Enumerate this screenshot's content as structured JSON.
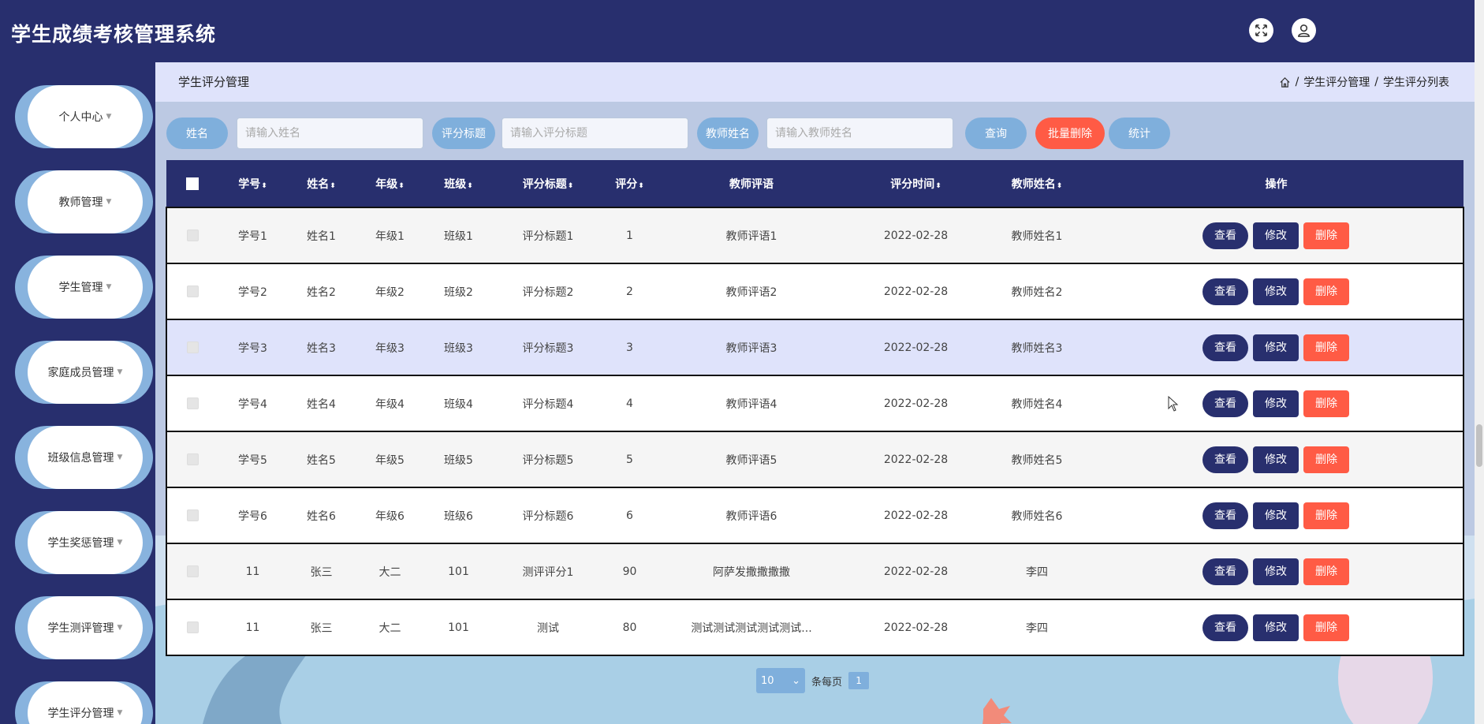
{
  "header": {
    "title": "学生成绩考核管理系统"
  },
  "sidebar": {
    "items": [
      {
        "label": "个人中心"
      },
      {
        "label": "教师管理"
      },
      {
        "label": "学生管理"
      },
      {
        "label": "家庭成员管理"
      },
      {
        "label": "班级信息管理"
      },
      {
        "label": "学生奖惩管理"
      },
      {
        "label": "学生测评管理"
      },
      {
        "label": "学生评分管理"
      }
    ]
  },
  "breadbar": {
    "page_title": "学生评分管理",
    "crumb_1": "学生评分管理",
    "crumb_2": "学生评分列表",
    "separator": "/"
  },
  "filters": {
    "name_label": "姓名",
    "name_placeholder": "请输入姓名",
    "title_label": "评分标题",
    "title_placeholder": "请输入评分标题",
    "teacher_label": "教师姓名",
    "teacher_placeholder": "请输入教师姓名",
    "search_label": "查询",
    "batch_delete_label": "批量删除",
    "stats_label": "统计"
  },
  "table": {
    "headers": {
      "id": "学号",
      "name": "姓名",
      "grade": "年级",
      "class": "班级",
      "title": "评分标题",
      "score": "评分",
      "comment": "教师评语",
      "time": "评分时间",
      "teacher": "教师姓名",
      "actions": "操作"
    },
    "rows": [
      {
        "id": "学号1",
        "name": "姓名1",
        "grade": "年级1",
        "class": "班级1",
        "title": "评分标题1",
        "score": "1",
        "comment": "教师评语1",
        "time": "2022-02-28",
        "teacher": "教师姓名1"
      },
      {
        "id": "学号2",
        "name": "姓名2",
        "grade": "年级2",
        "class": "班级2",
        "title": "评分标题2",
        "score": "2",
        "comment": "教师评语2",
        "time": "2022-02-28",
        "teacher": "教师姓名2"
      },
      {
        "id": "学号3",
        "name": "姓名3",
        "grade": "年级3",
        "class": "班级3",
        "title": "评分标题3",
        "score": "3",
        "comment": "教师评语3",
        "time": "2022-02-28",
        "teacher": "教师姓名3"
      },
      {
        "id": "学号4",
        "name": "姓名4",
        "grade": "年级4",
        "class": "班级4",
        "title": "评分标题4",
        "score": "4",
        "comment": "教师评语4",
        "time": "2022-02-28",
        "teacher": "教师姓名4"
      },
      {
        "id": "学号5",
        "name": "姓名5",
        "grade": "年级5",
        "class": "班级5",
        "title": "评分标题5",
        "score": "5",
        "comment": "教师评语5",
        "time": "2022-02-28",
        "teacher": "教师姓名5"
      },
      {
        "id": "学号6",
        "name": "姓名6",
        "grade": "年级6",
        "class": "班级6",
        "title": "评分标题6",
        "score": "6",
        "comment": "教师评语6",
        "time": "2022-02-28",
        "teacher": "教师姓名6"
      },
      {
        "id": "11",
        "name": "张三",
        "grade": "大二",
        "class": "101",
        "title": "测评评分1",
        "score": "90",
        "comment": "阿萨发撒撒撒撒",
        "time": "2022-02-28",
        "teacher": "李四"
      },
      {
        "id": "11",
        "name": "张三",
        "grade": "大二",
        "class": "101",
        "title": "测试",
        "score": "80",
        "comment": "测试测试测试测试测试...",
        "time": "2022-02-28",
        "teacher": "李四"
      }
    ],
    "action_view": "查看",
    "action_edit": "修改",
    "action_delete": "删除"
  },
  "pager": {
    "page_size": "10",
    "per_page_label": "条每页",
    "current_page": "1"
  },
  "colors": {
    "primary": "#282f6e",
    "accent_blue": "#7fafdc",
    "danger": "#ff5b45",
    "breadbar": "#dfe3fb"
  }
}
